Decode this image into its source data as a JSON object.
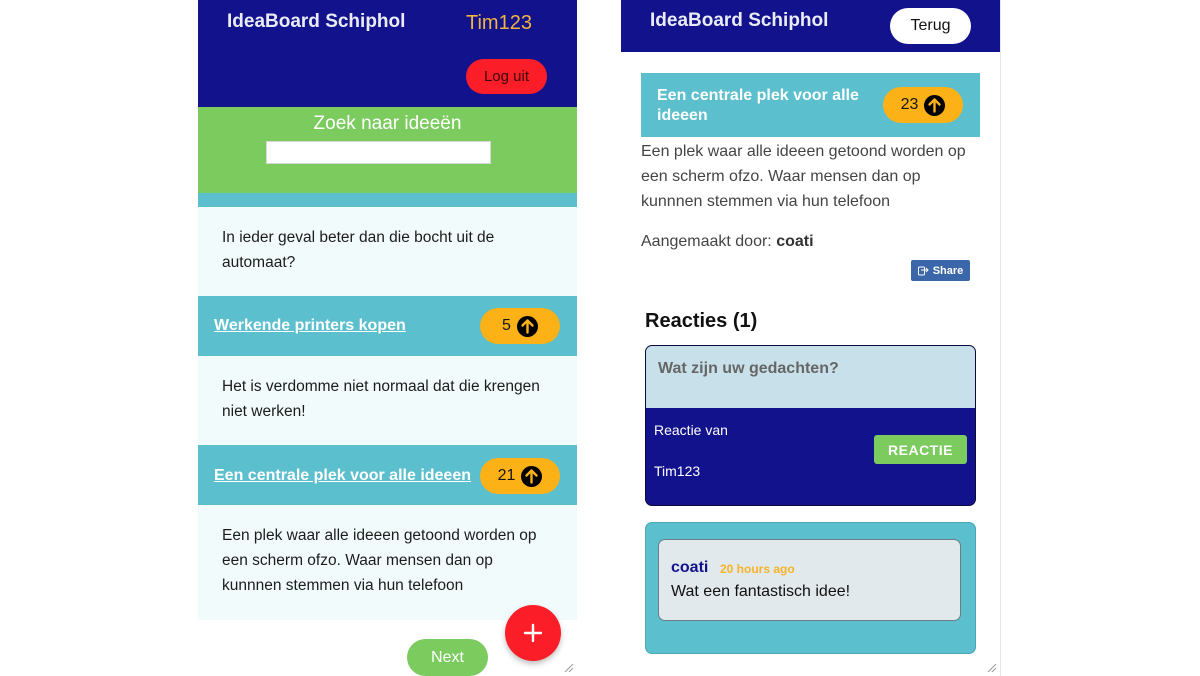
{
  "left": {
    "header": {
      "title": "IdeaBoard Schiphol",
      "username": "Tim123",
      "logout_label": "Log uit"
    },
    "search": {
      "label": "Zoek naar ideeën",
      "value": ""
    },
    "first_card_body": "In ieder geval beter dan die bocht uit de automaat?",
    "ideas": [
      {
        "title": "Werkende printers kopen",
        "votes": "5",
        "description": "Het is verdomme niet normaal dat die krengen niet werken!"
      },
      {
        "title": "Een centrale plek voor alle ideeen",
        "votes": "21",
        "description": "Een plek waar alle ideeen getoond worden op een scherm ofzo. Waar mensen dan op kunnnen stemmen via hun telefoon"
      }
    ],
    "next_label": "Next",
    "fab_icon": "plus-icon"
  },
  "right": {
    "header": {
      "title": "IdeaBoard Schiphol",
      "back_label": "Terug"
    },
    "idea": {
      "title": "Een centrale plek voor alle ideeen",
      "votes": "23",
      "description": "Een plek waar alle ideeen getoond worden op een scherm ofzo. Waar mensen dan op kunnnen stemmen via hun telefoon",
      "created_prefix": "Aangemaakt door:",
      "created_by": "coati",
      "share_label": "Share"
    },
    "reactions": {
      "title": "Reacties (1)",
      "input_placeholder": "Wat zijn uw gedachten?",
      "reply_of_label": "Reactie van",
      "reply_user": "Tim123",
      "submit_label": "REACTIE",
      "comments": [
        {
          "author": "coati",
          "time": "20 hours ago",
          "text": "Wat een fantastisch idee!"
        }
      ]
    }
  },
  "colors": {
    "navy": "#12128c",
    "teal": "#5cbfcd",
    "green": "#7bcb5f",
    "red": "#fb1e28",
    "amber": "#fcb116"
  }
}
